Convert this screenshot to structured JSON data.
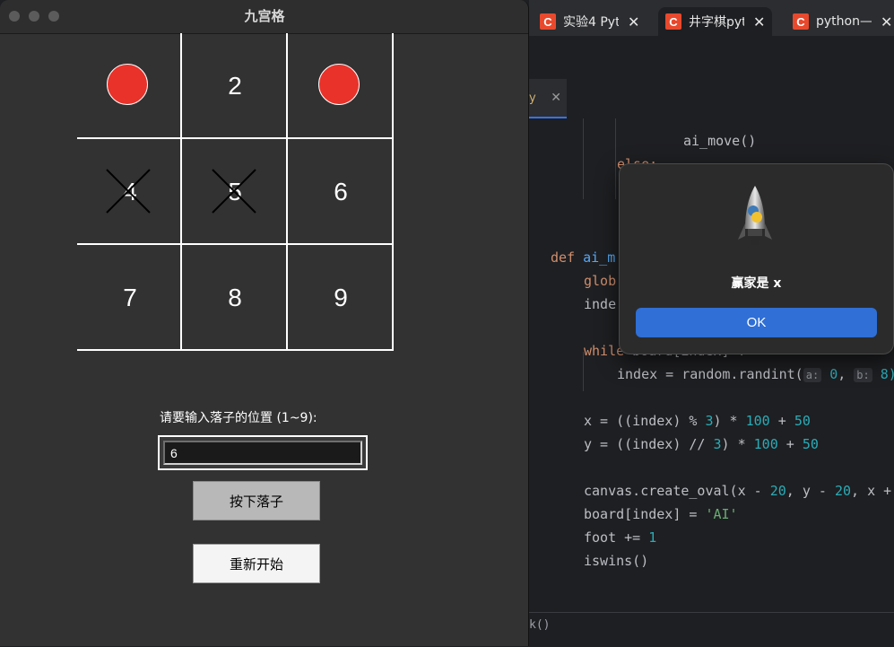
{
  "window": {
    "title": "九宫格"
  },
  "board": {
    "cells": [
      "",
      "2",
      "",
      "4",
      "5",
      "6",
      "7",
      "8",
      "9"
    ],
    "marks": {
      "ai_cells": [
        1,
        3
      ],
      "x_cells": [
        4,
        5
      ]
    }
  },
  "form": {
    "prompt": "请要输入落子的位置 (1~9):",
    "input_value": "6",
    "place_button": "按下落子",
    "restart_button": "重新开始"
  },
  "dialog": {
    "message": "赢家是 x",
    "ok_label": "OK"
  },
  "browser": {
    "tabs": [
      {
        "icon": "C",
        "label": "实验4 Pyt",
        "close": "✕"
      },
      {
        "icon": "C",
        "label": "井字棋pyt",
        "close": "✕"
      },
      {
        "icon": "C",
        "label": "python—",
        "close": "✕"
      }
    ]
  },
  "editor": {
    "tab_label": "y",
    "tab_close": "✕",
    "status_text": "k()",
    "code": {
      "l1": "ai_move()",
      "l2": "else:",
      "l3_kw": "def",
      "l3_fn": "ai_m",
      "l4": "glob",
      "l5": "inde",
      "l6_kw": "while",
      "l6_rest": " board[index] != ''",
      "l7_a": "index = random.randint(",
      "l7_hint_a": "a:",
      "l7_n0": "0",
      "l7_sep": ", ",
      "l7_hint_b": "b:",
      "l7_n8": "8)",
      "l8_a": "x = ((index) % ",
      "l8_n3": "3",
      "l8_b": ") * ",
      "l8_n100": "100",
      "l8_c": " + ",
      "l8_n50": "50",
      "l9_a": "y = ((index) // ",
      "l9_n3": "3",
      "l9_b": ") * ",
      "l9_n100": "100",
      "l9_c": " + ",
      "l9_n50": "50",
      "l10_a": "canvas.create_oval(x - ",
      "l10_n20a": "20",
      "l10_b": ", y - ",
      "l10_n20b": "20",
      "l10_c": ", x +",
      "l11_a": "board[index] = ",
      "l11_s": "'AI'",
      "l12_a": "foot += ",
      "l12_n": "1",
      "l13": "iswins()"
    }
  }
}
